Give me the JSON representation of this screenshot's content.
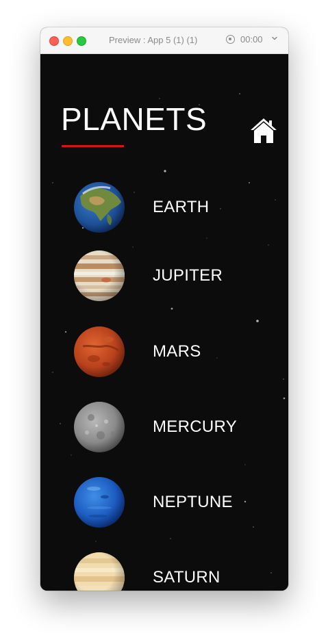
{
  "window": {
    "title": "Preview : App 5 (1) (1)",
    "timer": "00:00",
    "traffic_lights": {
      "close": "#fe5f57",
      "minimize": "#febc2e",
      "maximize": "#28c840"
    }
  },
  "app": {
    "title": "PLANETS",
    "accent_color": "#d61414",
    "background_color": "#0c0c0c",
    "home_icon": "home-icon"
  },
  "planets": [
    {
      "name": "EARTH",
      "icon": "earth-image"
    },
    {
      "name": "JUPITER",
      "icon": "jupiter-image"
    },
    {
      "name": "MARS",
      "icon": "mars-image"
    },
    {
      "name": "MERCURY",
      "icon": "mercury-image"
    },
    {
      "name": "NEPTUNE",
      "icon": "neptune-image"
    },
    {
      "name": "SATURN",
      "icon": "saturn-image"
    }
  ]
}
